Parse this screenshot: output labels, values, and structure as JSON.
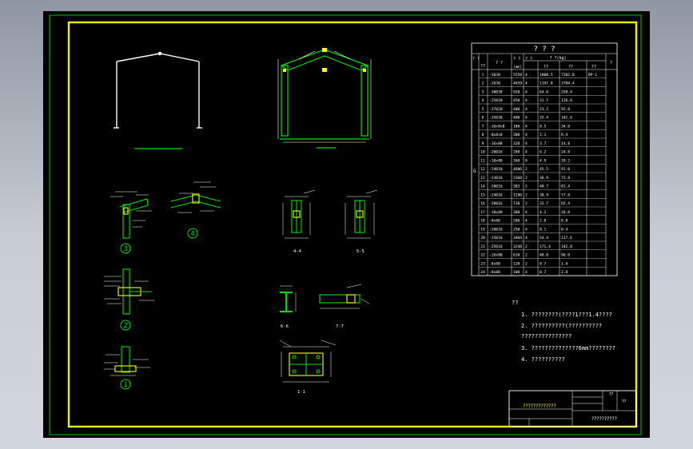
{
  "viewport": {
    "background": "#000000",
    "frame_color": "#ffff00",
    "outer_color": "#00ff00"
  },
  "colors": {
    "frame": "#f2f200",
    "green": "#00e000",
    "white": "#ffffff",
    "yellow": "#ffe600",
    "orange": "#ff9a00"
  },
  "details": {
    "d1": "1",
    "d2": "2",
    "d3": "3",
    "d4": "4",
    "sec44": "4-4",
    "sec55": "5-5",
    "sec66": "6-6",
    "sec77": "7-7",
    "sec11": "1-1"
  },
  "table": {
    "title": "? ? ?",
    "header": {
      "c1": "? ?",
      "c2": "? ?",
      "c3": "? ?",
      "c4": "? ?",
      "c5": "? ?(kg)",
      "c6": "?"
    },
    "subheader": {
      "a": "??",
      "b": "(mm)",
      "c": "??",
      "d": "??",
      "e": "??"
    },
    "side_label": "G",
    "rows": [
      {
        "no": "1",
        "spec": "-3030",
        "len": "5558",
        "qty": "4",
        "w1": "1800.5",
        "w2": "7202.0",
        "note": "BP-1"
      },
      {
        "no": "2",
        "spec": "-2030",
        "len": "4659",
        "qty": "4",
        "w1": "1197.8",
        "w2": "3784.4",
        "note": ""
      },
      {
        "no": "3",
        "spec": "-30030",
        "len": "920",
        "qty": "4",
        "w1": "64.6",
        "w2": "258.4",
        "note": ""
      },
      {
        "no": "4",
        "spec": "-25020",
        "len": "450",
        "qty": "4",
        "w1": "31.7",
        "w2": "126.6",
        "note": ""
      },
      {
        "no": "5",
        "spec": "-37020",
        "len": "400",
        "qty": "4",
        "w1": "23.2",
        "w2": "92.8",
        "note": ""
      },
      {
        "no": "6",
        "spec": "-35030",
        "len": "400",
        "qty": "4",
        "w1": "25.4",
        "w2": "101.6",
        "note": ""
      },
      {
        "no": "7",
        "spec": "-16x8x8",
        "len": "180",
        "qty": "4",
        "w1": "8.5",
        "w2": "34.0",
        "note": ""
      },
      {
        "no": "8",
        "spec": "-8x8x8",
        "len": "200",
        "qty": "4",
        "w1": "2.1",
        "w2": "8.4",
        "note": ""
      },
      {
        "no": "9",
        "spec": "-16x88",
        "len": "320",
        "qty": "4",
        "w1": "3.7",
        "w2": "14.8",
        "note": ""
      },
      {
        "no": "10",
        "spec": "-20016",
        "len": "280",
        "qty": "4",
        "w1": "6.2",
        "w2": "24.8",
        "note": ""
      },
      {
        "no": "11",
        "spec": "-10x88",
        "len": "360",
        "qty": "8",
        "w1": "4.9",
        "w2": "39.2",
        "note": ""
      },
      {
        "no": "12",
        "spec": "-24018",
        "len": "4606",
        "qty": "2",
        "w1": "45.5",
        "w2": "91.0",
        "note": ""
      },
      {
        "no": "13",
        "spec": "-23016",
        "len": "2360",
        "qty": "2",
        "w1": "36.9",
        "w2": "73.8",
        "note": ""
      },
      {
        "no": "14",
        "spec": "-20016",
        "len": "383",
        "qty": "2",
        "w1": "40.7",
        "w2": "81.4",
        "note": ""
      },
      {
        "no": "15",
        "spec": "-24016",
        "len": "1296",
        "qty": "2",
        "w1": "38.9",
        "w2": "77.8",
        "note": ""
      },
      {
        "no": "16",
        "spec": "-20016",
        "len": "720",
        "qty": "2",
        "w1": "32.7",
        "w2": "65.4",
        "note": ""
      },
      {
        "no": "17",
        "spec": "-10x88",
        "len": "300",
        "qty": "4",
        "w1": "4.2",
        "w2": "16.8",
        "note": ""
      },
      {
        "no": "18",
        "spec": "-8x88",
        "len": "200",
        "qty": "4",
        "w1": "2.0",
        "w2": "8.0",
        "note": ""
      },
      {
        "no": "19",
        "spec": "-20016",
        "len": "250",
        "qty": "4",
        "w1": "0.1",
        "w2": "0.4",
        "note": ""
      },
      {
        "no": "20",
        "spec": "-25016",
        "len": "3404",
        "qty": "4",
        "w1": "54.4",
        "w2": "217.6",
        "note": ""
      },
      {
        "no": "21",
        "spec": "-25016",
        "len": "3248",
        "qty": "2",
        "w1": "171.4",
        "w2": "342.8",
        "note": ""
      },
      {
        "no": "22",
        "spec": "-16x88",
        "len": "610",
        "qty": "2",
        "w1": "48.0",
        "w2": "96.0",
        "note": ""
      },
      {
        "no": "23",
        "spec": "-8x88",
        "len": "120",
        "qty": "2",
        "w1": "0.7",
        "w2": "1.4",
        "note": ""
      },
      {
        "no": "24",
        "spec": "-8x88",
        "len": "100",
        "qty": "4",
        "w1": "0.7",
        "w2": "2.8",
        "note": ""
      }
    ]
  },
  "notes": {
    "title": "??",
    "items": [
      "1. ????????(????1???1.4????",
      "2. ??????????(??????????",
      "   ???????????????",
      "3. ??????????????6mm????????",
      "4. ??????????"
    ]
  },
  "titleblock": {
    "school": "?????????????",
    "drawing": "??????????",
    "mark": "??",
    "sheet": "??"
  }
}
